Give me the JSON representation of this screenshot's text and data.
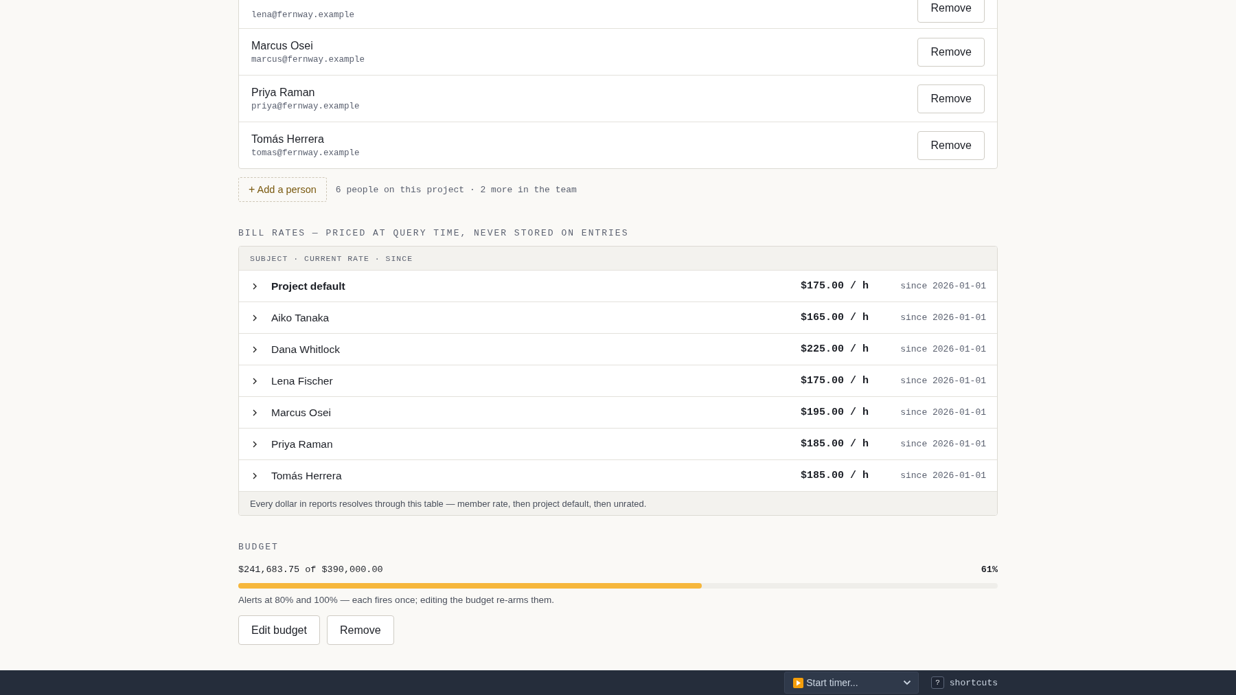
{
  "members": [
    {
      "email": "lena@fernway.example",
      "action": "Remove"
    },
    {
      "name": "Marcus Osei",
      "email": "marcus@fernway.example",
      "action": "Remove"
    },
    {
      "name": "Priya Raman",
      "email": "priya@fernway.example",
      "action": "Remove"
    },
    {
      "name": "Tomás Herrera",
      "email": "tomas@fernway.example",
      "action": "Remove"
    }
  ],
  "add_person": {
    "icon": "+",
    "label": "Add a person",
    "note": "6 people on this project · 2 more in the team"
  },
  "bill_rates": {
    "heading": "BILL RATES — PRICED AT QUERY TIME, NEVER STORED ON ENTRIES",
    "columns_header": "SUBJECT · CURRENT RATE · SINCE",
    "rows": [
      {
        "kind": "default",
        "subject": "Project default",
        "rate": "$175.00 / h",
        "since": "since 2026-01-01",
        "expanded": false
      },
      {
        "kind": "member",
        "subject": "Aiko Tanaka",
        "rate": "$165.00 / h",
        "since": "since 2026-01-01",
        "expanded": false
      },
      {
        "kind": "member",
        "subject": "Dana Whitlock",
        "rate": "$225.00 / h",
        "since": "since 2026-01-01",
        "expanded": false
      },
      {
        "kind": "member",
        "subject": "Lena Fischer",
        "rate": "$175.00 / h",
        "since": "since 2026-01-01",
        "expanded": false
      },
      {
        "kind": "member",
        "subject": "Marcus Osei",
        "rate": "$195.00 / h",
        "since": "since 2026-01-01",
        "expanded": false
      },
      {
        "kind": "member",
        "subject": "Priya Raman",
        "rate": "$185.00 / h",
        "since": "since 2026-01-01",
        "expanded": false
      },
      {
        "kind": "member",
        "subject": "Tomás Herrera",
        "rate": "$185.00 / h",
        "since": "since 2026-01-01",
        "expanded": false
      }
    ],
    "footnote": "Every dollar in reports resolves through this table — member rate, then project default, then unrated."
  },
  "budget": {
    "heading": "BUDGET",
    "amount": "$241,683.75 of $390,000.00",
    "percent": "61%",
    "level": 0.61,
    "note": "Alerts at 80% and 100% — each fires once; editing the budget re-arms them.",
    "buttons": [
      "Edit budget",
      "Remove"
    ]
  },
  "bottom_bar": {
    "timer_placeholder": "Start timer...",
    "shortcut_key": "?",
    "shortcut_label": "shortcuts"
  }
}
